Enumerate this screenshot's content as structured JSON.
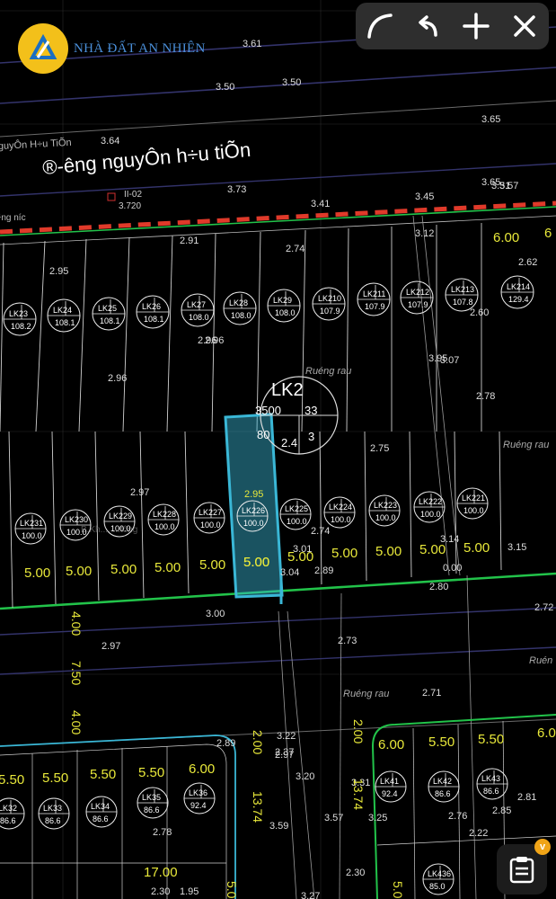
{
  "brand": {
    "name": "NHÀ ĐẤT AN NHIÊN"
  },
  "toolbar": {
    "tools": [
      "curve-tool",
      "undo",
      "add",
      "close"
    ]
  },
  "colors": {
    "accent": "#3ab7d6",
    "road": "#e03a2a",
    "boundary": "#22c34a",
    "dimension": "#e8e83a",
    "toolbar": "#2e2e2e",
    "badge": "#f0a417"
  },
  "street": {
    "name": "®-êng nguyÔn h÷u tiÕn",
    "name_small": "guyÔn H÷u TiÕn",
    "name_side": "¹ng n­íc"
  },
  "labels": {
    "block": "LK2",
    "block_circle_left": "3500",
    "block_circle_right": "33",
    "block_circle_mid": "2.4",
    "block_circle_r": "3",
    "block_circle_area": "80",
    "ruong_rau_1": "Ruéng rau",
    "ruong_rau_2": "Ruéng rau",
    "ruong_rau_3": "Ruéng rau",
    "ruong_rau_4": "Ruén",
    "code_ll02": "II-02",
    "code_ll02_val": "3.720",
    "selected_width": "5.00",
    "selected_elev": "2.95",
    "left_faint": "B.Kh.... ...tông"
  },
  "elevations": [
    "3.61",
    "3.50",
    "3.50",
    "3.65",
    "3.64",
    "3.73",
    "3.41",
    "3.45",
    "3.65",
    "3.51",
    "3.57",
    "2.91",
    "2.74",
    "2.96",
    "3.12",
    "2.95",
    "2.96",
    "2.96",
    "2.62",
    "2.60",
    "3.95",
    "3.07",
    "2.78",
    "2.75",
    "2.97",
    "2.74",
    "3.01",
    "3.04",
    "2.89",
    "3.14",
    "3.15",
    "0.00",
    "2.80",
    "2.72",
    "3.00",
    "2.97",
    "2.73",
    "2.71",
    "3.22",
    "2.37",
    "2.97",
    "2.89",
    "3.20",
    "3.31",
    "3.57",
    "3.25",
    "3.59",
    "2.78",
    "2.76",
    "2.85",
    "2.30",
    "2.30",
    "1.95",
    "3.27",
    "2.22",
    "2.81"
  ],
  "lots_top": [
    {
      "id": "LK2",
      "n": "3",
      "area": "108.2"
    },
    {
      "id": "LK2",
      "n": "4",
      "area": "108.1"
    },
    {
      "id": "LK2",
      "n": "5",
      "area": "108.1"
    },
    {
      "id": "LK2",
      "n": "6",
      "area": "108.1"
    },
    {
      "id": "LK2",
      "n": "7",
      "area": "108.0"
    },
    {
      "id": "LK2",
      "n": "8",
      "area": "108.0"
    },
    {
      "id": "LK2",
      "n": "9",
      "area": "108.0"
    },
    {
      "id": "LK2",
      "n": "10",
      "area": "107.9"
    },
    {
      "id": "LK2",
      "n": "11",
      "area": "107.9"
    },
    {
      "id": "LK2",
      "n": "12",
      "area": "107.9"
    },
    {
      "id": "LK2",
      "n": "13",
      "area": "107.8"
    },
    {
      "id": "LK2",
      "n": "14",
      "area": "129.4"
    }
  ],
  "lots_mid": [
    {
      "id": "LK2",
      "n": "31",
      "area": "100.0"
    },
    {
      "id": "LK2",
      "n": "30",
      "area": "100.0"
    },
    {
      "id": "LK2",
      "n": "29",
      "area": "100.0"
    },
    {
      "id": "LK2",
      "n": "28",
      "area": "100.0"
    },
    {
      "id": "LK2",
      "n": "27",
      "area": "100.0"
    },
    {
      "id": "LK2",
      "n": "26",
      "area": "100.0"
    },
    {
      "id": "LK2",
      "n": "25",
      "area": "100.0"
    },
    {
      "id": "LK2",
      "n": "24",
      "area": "100.0"
    },
    {
      "id": "LK2",
      "n": "23",
      "area": "100.0"
    },
    {
      "id": "LK2",
      "n": "22",
      "area": "100.0"
    },
    {
      "id": "LK2",
      "n": "21",
      "area": "100.0"
    }
  ],
  "lots_bottom_left": [
    {
      "id": "LK3",
      "n": "2",
      "area": "86.6"
    },
    {
      "id": "LK3",
      "n": "3",
      "area": "86.6"
    },
    {
      "id": "LK3",
      "n": "4",
      "area": "86.6"
    },
    {
      "id": "LK3",
      "n": "5",
      "area": "86.6"
    },
    {
      "id": "LK3",
      "n": "6",
      "area": "92.4"
    }
  ],
  "lots_bottom_right": [
    {
      "id": "LK4",
      "n": "1",
      "area": "92.4"
    },
    {
      "id": "LK4",
      "n": "2",
      "area": "86.6"
    },
    {
      "id": "LK4",
      "n": "3",
      "area": "86.6"
    },
    {
      "id": "LK4",
      "n": "36",
      "area": "85.0"
    }
  ],
  "dims_top": [
    "6.00",
    "6"
  ],
  "dims_mid": [
    "5.00",
    "5.00",
    "5.00",
    "5.00",
    "5.00",
    "5.00",
    "5.00",
    "5.00",
    "5.00",
    "5.00",
    "5.00"
  ],
  "dims_vertical_left": [
    "4.00",
    "7.50",
    "4.00"
  ],
  "dims_vertical_center": [
    "2.00",
    "13.74"
  ],
  "dims_vertical_right": [
    "2.00",
    "13.74"
  ],
  "dims_bottom_left": [
    "5.50",
    "5.50",
    "5.50",
    "5.50",
    "6.00",
    "17.00"
  ],
  "dims_bottom_right": [
    "6.00",
    "5.50",
    "5.50",
    "6.00"
  ],
  "dims_bottom_edge": [
    "5.0",
    "5.0"
  ]
}
